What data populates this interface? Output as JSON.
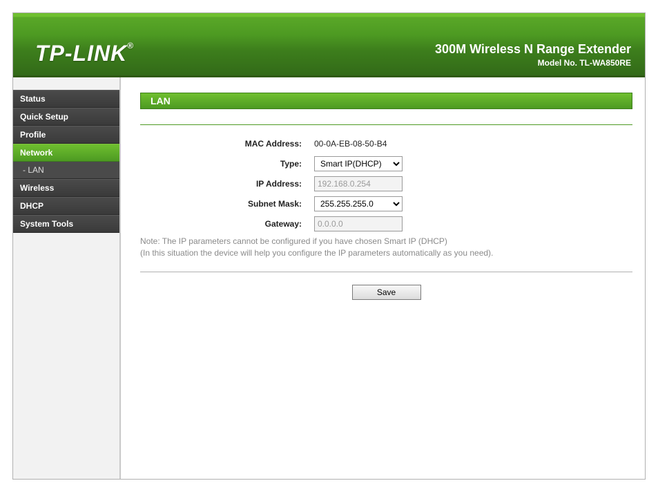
{
  "header": {
    "logo": "TP-LINK",
    "product_title": "300M Wireless N Range Extender",
    "model_label": "Model No. TL-WA850RE"
  },
  "sidebar": {
    "items": [
      {
        "label": "Status"
      },
      {
        "label": "Quick Setup"
      },
      {
        "label": "Profile"
      },
      {
        "label": "Network",
        "active": true
      },
      {
        "label": "- LAN",
        "sub": true
      },
      {
        "label": "Wireless"
      },
      {
        "label": "DHCP"
      },
      {
        "label": "System Tools"
      }
    ]
  },
  "section": {
    "title": "LAN"
  },
  "form": {
    "mac_label": "MAC Address:",
    "mac_value": "00-0A-EB-08-50-B4",
    "type_label": "Type:",
    "type_value": "Smart IP(DHCP)",
    "ip_label": "IP Address:",
    "ip_value": "192.168.0.254",
    "mask_label": "Subnet Mask:",
    "mask_value": "255.255.255.0",
    "gateway_label": "Gateway:",
    "gateway_value": "0.0.0.0",
    "note_line1": "Note: The IP parameters cannot be configured if you have chosen Smart IP (DHCP)",
    "note_line2": "(In this situation the device will help you configure the IP parameters automatically as you need).",
    "save_label": "Save"
  }
}
